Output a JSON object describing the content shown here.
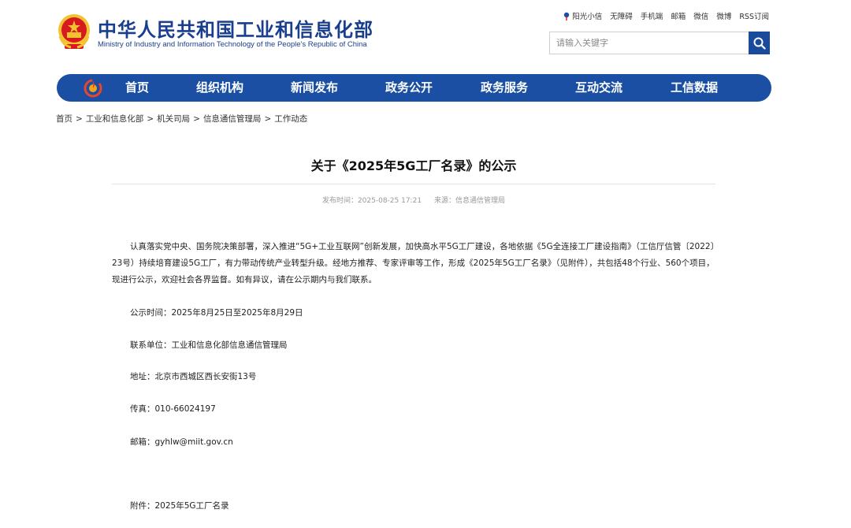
{
  "header": {
    "title": "中华人民共和国工业和信息化部",
    "subtitle": "Ministry of Industry and Information Technology of the People's Republic of China"
  },
  "toplinks": [
    "阳光小信",
    "无障碍",
    "手机端",
    "邮箱",
    "微信",
    "微博",
    "RSS订阅"
  ],
  "search": {
    "placeholder": "请输入关键字"
  },
  "nav": [
    "首页",
    "组织机构",
    "新闻发布",
    "政务公开",
    "政务服务",
    "互动交流",
    "工信数据"
  ],
  "breadcrumb": [
    "首页",
    "工业和信息化部",
    "机关司局",
    "信息通信管理局",
    "工作动态"
  ],
  "article": {
    "title": "关于《2025年5G工厂名录》的公示",
    "publish_time": "发布时间：2025-08-25 17:21",
    "source": "来源：信息通信管理局",
    "paragraph": "认真落实党中央、国务院决策部署，深入推进“5G+工业互联网”创新发展，加快高水平5G工厂建设，各地依据《5G全连接工厂建设指南》（工信厅信管〔2022〕23号）持续培育建设5G工厂，有力带动传统产业转型升级。经地方推荐、专家评审等工作，形成《2025年5G工厂名录》（见附件），共包括48个行业、560个项目，现进行公示，欢迎社会各界监督。如有异议，请在公示期内与我们联系。",
    "period": "公示时间：2025年8月25日至2025年8月29日",
    "contact_unit": "联系单位：工业和信息化部信息通信管理局",
    "address": "地址：北京市西城区西长安街13号",
    "fax": "传真：010-66024197",
    "email": "邮箱：gyhlw@miit.gov.cn",
    "attachment": "附件：2025年5G工厂名录"
  },
  "colors": {
    "brand_blue": "#1a4fa3",
    "title_blue": "#1a3e8e",
    "emblem_red": "#d71920",
    "emblem_gold": "#f2c230"
  },
  "icons": {
    "emblem": "national-emblem-icon",
    "nav_logo": "miit-logo-icon",
    "search": "search-icon",
    "toplink": "pin-icon"
  }
}
